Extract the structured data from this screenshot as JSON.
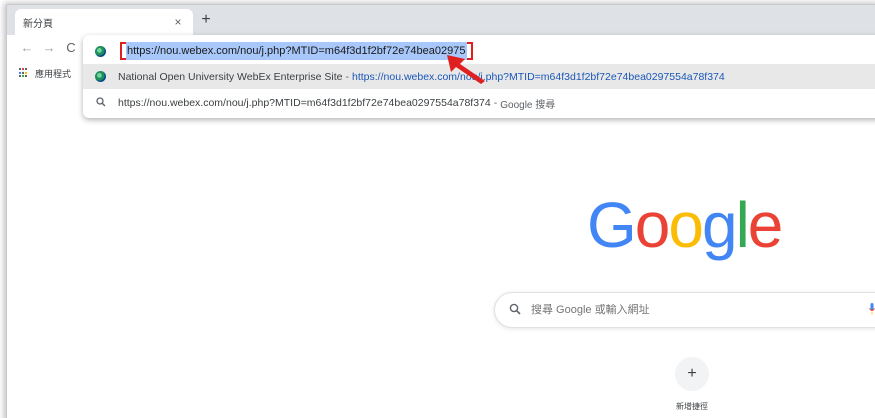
{
  "tab": {
    "title": "新分頁",
    "close_glyph": "×",
    "newtab_glyph": "+"
  },
  "toolbar": {
    "back_glyph": "←",
    "forward_glyph": "→",
    "reload_glyph": "C"
  },
  "bookmarks": {
    "label": "應用程式"
  },
  "omnibox": {
    "input_value": "https://nou.webex.com/nou/j.php?MTID=m64f3d1f2bf72e74bea02975",
    "suggestions": [
      {
        "icon": "site-icon",
        "title": "National Open University WebEx Enterprise Site",
        "separator": "-",
        "url": "https://nou.webex.com/nou/j.php?MTID=m64f3d1f2bf72e74bea0297554a78f374"
      },
      {
        "icon": "search-icon",
        "query": "https://nou.webex.com/nou/j.php?MTID=m64f3d1f2bf72e74bea0297554a78f374",
        "separator": "-",
        "engine": "Google 搜尋"
      }
    ]
  },
  "ntp": {
    "logo_letters": [
      "G",
      "o",
      "o",
      "g",
      "l",
      "e"
    ],
    "search_placeholder": "搜尋 Google 或輸入網址",
    "shortcut_glyph": "+",
    "shortcut_label": "新增捷徑"
  },
  "colors": {
    "highlight_box": "#e02020",
    "selection": "#a8c7fa",
    "link": "#1a57b8"
  }
}
